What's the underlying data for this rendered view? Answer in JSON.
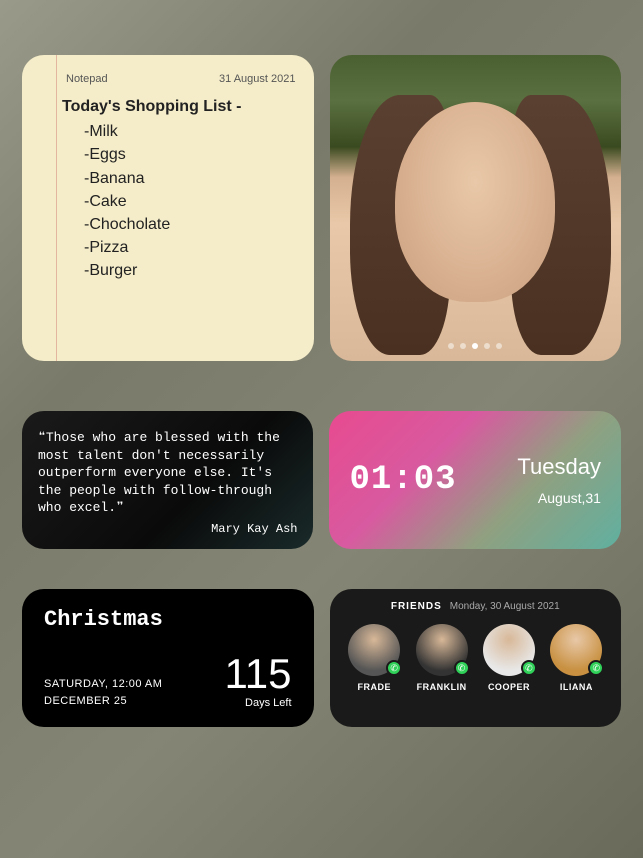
{
  "notepad": {
    "label": "Notepad",
    "date": "31 August 2021",
    "title": "Today's Shopping List -",
    "items": [
      "-Milk",
      "-Eggs",
      "-Banana",
      "-Cake",
      "-Chocholate",
      "-Pizza",
      "-Burger"
    ]
  },
  "photo": {
    "page_count": 5,
    "active_page": 2
  },
  "quote": {
    "text": "❝Those who are blessed with the most talent don't necessarily outperform everyone else. It's the people with follow-through who excel.❞",
    "author": "Mary Kay Ash"
  },
  "clock": {
    "time": "01:03",
    "day": "Tuesday",
    "date": "August,31"
  },
  "countdown": {
    "title": "Christmas",
    "day_time": "SATURDAY, 12:00 AM",
    "date": "DECEMBER 25",
    "number": "115",
    "label": "Days Left"
  },
  "friends": {
    "title": "FRIENDS",
    "date": "Monday, 30 August 2021",
    "list": [
      {
        "name": "FRADE"
      },
      {
        "name": "FRANKLIN"
      },
      {
        "name": "COOPER"
      },
      {
        "name": "ILIANA"
      }
    ]
  }
}
